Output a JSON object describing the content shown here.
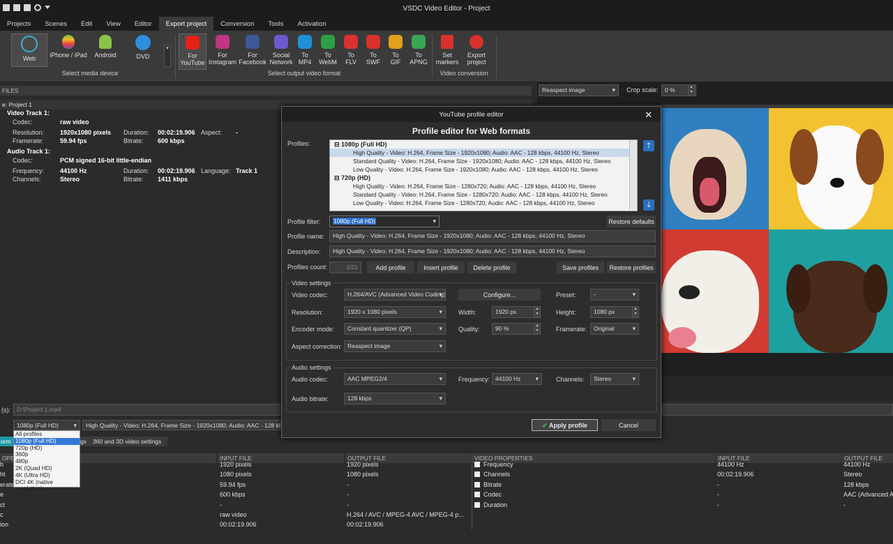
{
  "window": {
    "title": "VSDC Video Editor - Project"
  },
  "menu": [
    "Projects",
    "Scenes",
    "Edit",
    "View",
    "Editor",
    "Export project",
    "Conversion",
    "Tools",
    "Activation"
  ],
  "ribbon": {
    "devices": [
      {
        "label": "Web",
        "icon": "globe-icon"
      },
      {
        "label": "iPhone / iPad",
        "icon": "apple-icon"
      },
      {
        "label": "Android",
        "icon": "android-icon"
      },
      {
        "label": "DVD",
        "icon": "dvd-icon"
      }
    ],
    "devices_group": "Select media device",
    "formats": [
      {
        "label": "For\nYouTube",
        "icon": "youtube-icon",
        "color": "#e62117"
      },
      {
        "label": "For\nInstagram",
        "icon": "instagram-icon",
        "color": "#c13584"
      },
      {
        "label": "For\nFacebook",
        "icon": "facebook-icon",
        "color": "#3b5998"
      },
      {
        "label": "Social\nNetwork",
        "icon": "social-network-icon",
        "color": "#6a5acd"
      },
      {
        "label": "To\nMP4",
        "icon": "mp4-icon",
        "color": "#1f8fd6"
      },
      {
        "label": "To\nWebM",
        "icon": "webm-icon",
        "color": "#2e9e44"
      },
      {
        "label": "To\nFLV",
        "icon": "flv-icon",
        "color": "#d9312e"
      },
      {
        "label": "To\nSWF",
        "icon": "swf-icon",
        "color": "#d9312e"
      },
      {
        "label": "To\nGIF",
        "icon": "gif-icon",
        "color": "#e0a21b"
      },
      {
        "label": "To\nAPNG",
        "icon": "apng-icon",
        "color": "#3aa655"
      }
    ],
    "formats_group": "Select output video format",
    "conversion": [
      {
        "label": "Set\nmarkers",
        "icon": "marker-icon"
      },
      {
        "label": "Export\nproject",
        "icon": "export-icon"
      }
    ],
    "conversion_group": "Video conversion"
  },
  "files": {
    "header": "FILES",
    "project": "e: Project 1",
    "video_track": "Video Track 1:",
    "codec_label": "Codec:",
    "codec": "raw video",
    "resolution_label": "Resolution:",
    "resolution": "1920x1080 pixels",
    "duration_label": "Duration:",
    "duration": "00:02:19.906",
    "aspect_label": "Aspect:",
    "aspect": "-",
    "framerate_label": "Framerate:",
    "framerate": "59.94 fps",
    "bitrate_label": "Bitrate:",
    "bitrate": "600 kbps",
    "audio_track": "Audio Track 1:",
    "acodec": "PCM signed 16-bit little-endian",
    "frequency_label": "Frequency:",
    "frequency": "44100 Hz",
    "language_label": "Language:",
    "language": "Track 1",
    "channels_label": "Channels:",
    "channels": "Stereo",
    "abitrate": "1411 kbps"
  },
  "preview": {
    "reaspect": "Reaspect image",
    "crop_label": "Crop scale:",
    "crop": "0 %"
  },
  "output": {
    "label": "(s):",
    "path": "D:\\Project 1.mp4",
    "profile": "1080p (Full HD)",
    "profile_desc": "High Quality - Video: H.264, Frame Size - 1920x1080; Audio: AAC - 128 kbps,"
  },
  "dropdown": [
    "All profiles",
    "1080p (Full HD)",
    "720p (HD)",
    "360p",
    "480p",
    "2K (Quad HD)",
    "4K (Ultra HD)",
    "DCI 4K (native resolution)"
  ],
  "tabs": {
    "t1": "orm",
    "t2": "gs",
    "t3": "360 and 3D video settings"
  },
  "table_left": {
    "headers": [
      "OPE",
      "INPUT FILE",
      "OUTPUT FILE"
    ],
    "names": [
      "h",
      "ht",
      "erate",
      "e",
      "ct",
      "c",
      "ion"
    ],
    "input": [
      "1920 pixels",
      "1080 pixels",
      "59.94 fps",
      "600 kbps",
      "-",
      "raw video",
      "00:02:19.906"
    ],
    "output": [
      "1920 pixels",
      "1080 pixels",
      "-",
      "-",
      "-",
      "H.264 / AVC / MPEG-4 AVC / MPEG-4 p...",
      "00:02:19.906"
    ]
  },
  "table_right": {
    "headers": [
      "VIDEO PROPERTIES",
      "INPUT FILE",
      "OUTPUT FILE"
    ],
    "names": [
      "Frequency",
      "Channels",
      "Bitrate",
      "Codec",
      "Duration"
    ],
    "input": [
      "44100 Hz",
      "00:02:19.906",
      "-",
      "-",
      "-"
    ],
    "output": [
      "44100 Hz",
      "Stereo",
      "128 kbps",
      "AAC (Advanced A",
      "-"
    ]
  },
  "dialog": {
    "title": "YouTube profile editor",
    "heading": "Profile editor for Web formats",
    "profiles_label": "Profiles:",
    "profiles": [
      {
        "group": "1080p (Full HD)",
        "items": [
          "High Quality - Video: H.264, Frame Size - 1920x1080; Audio: AAC - 128 kbps, 44100 Hz, Stereo",
          "Standard Quality - Video: H.264, Frame Size - 1920x1080; Audio: AAC - 128 kbps, 44100 Hz, Stereo",
          "Low Quality - Video: H.264, Frame Size - 1920x1080; Audio: AAC - 128 kbps, 44100 Hz, Stereo"
        ]
      },
      {
        "group": "720p (HD)",
        "items": [
          "High Quality - Video: H.264, Frame Size - 1280x720; Audio: AAC - 128 kbps, 44100 Hz, Stereo",
          "Standard Quality - Video: H.264, Frame Size - 1280x720; Audio: AAC - 128 kbps, 44100 Hz, Stereo",
          "Low Quality - Video: H.264, Frame Size - 1280x720; Audio: AAC - 128 kbps, 44100 Hz, Stereo"
        ]
      }
    ],
    "filter_label": "Profile filter:",
    "filter": "1080p (Full HD)",
    "restore_defaults": "Restore defaults",
    "name_label": "Profile name:",
    "name": "High Quality - Video: H.264, Frame Size - 1920x1080; Audio: AAC - 128 kbps, 44100 Hz, Stereo",
    "desc_label": "Description:",
    "desc": "High Quality - Video: H.264, Frame Size - 1920x1080; Audio: AAC - 128 kbps, 44100 Hz, Stereo",
    "count_label": "Profiles count:",
    "count": "1/21",
    "add": "Add profile",
    "insert": "Insert profile",
    "delete": "Delete profile",
    "save": "Save profiles",
    "restore": "Restore profiles",
    "video_settings": "Video settings",
    "vcodec_label": "Video codec:",
    "vcodec": "H.264/AVC (Advanced Video Coding)",
    "configure": "Configure...",
    "preset_label": "Preset:",
    "preset": "-",
    "res_label": "Resolution:",
    "res": "1920 x 1080 pixels",
    "width_label": "Width:",
    "width": "1920 px",
    "height_label": "Height:",
    "height": "1080 px",
    "enc_label": "Encoder mode:",
    "enc": "Constant quantizer (QP)",
    "quality_label": "Quality:",
    "quality": "90 %",
    "fr_label": "Framerate:",
    "fr": "Original",
    "aspect_label": "Aspect correction:",
    "aspect": "Reaspect image",
    "audio_settings": "Audio settings",
    "acodec_label": "Audio codec:",
    "acodec": "AAC MPEG2/4",
    "freq_label": "Frequency:",
    "freq": "44100 Hz",
    "ch_label": "Channels:",
    "ch": "Stereo",
    "abitrate_label": "Audio bitrate:",
    "abitrate": "128 kbps",
    "apply": "Apply profile",
    "cancel": "Cancel"
  }
}
